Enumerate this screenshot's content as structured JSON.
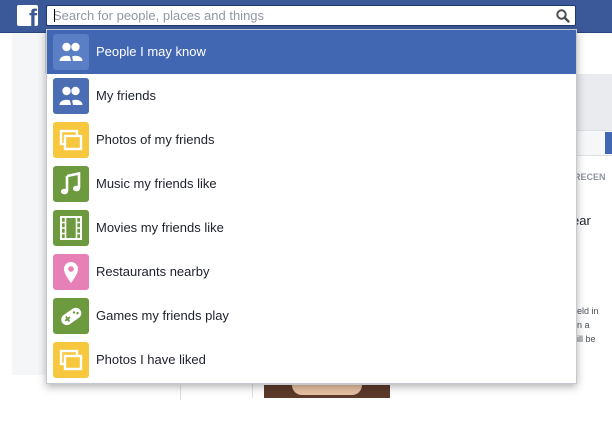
{
  "header": {
    "logo_letter": "f",
    "search": {
      "placeholder": "Search for people, places and things",
      "value": ""
    }
  },
  "background": {
    "frag_recent": "T RECEN",
    "frag_ear": "ear",
    "frag_lines": [
      "eld in",
      "n a",
      "ill be"
    ]
  },
  "suggestions": [
    {
      "label": "People I may know",
      "icon": "people-icon",
      "color": "#ffffff",
      "active": true
    },
    {
      "label": "My friends",
      "icon": "people-icon",
      "color": "#4a6db4",
      "active": false
    },
    {
      "label": "Photos of my friends",
      "icon": "photos-icon",
      "color": "#f7c73d",
      "active": false
    },
    {
      "label": "Music my friends like",
      "icon": "music-icon",
      "color": "#6d9a3f",
      "active": false
    },
    {
      "label": "Movies my friends like",
      "icon": "film-icon",
      "color": "#6d9a3f",
      "active": false
    },
    {
      "label": "Restaurants nearby",
      "icon": "location-pin-icon",
      "color": "#e780b6",
      "active": false
    },
    {
      "label": "Games my friends play",
      "icon": "gamepad-icon",
      "color": "#6d9a3f",
      "active": false
    },
    {
      "label": "Photos I have liked",
      "icon": "photos-icon",
      "color": "#f7c73d",
      "active": false
    }
  ],
  "colors": {
    "brand_blue": "#3b5998",
    "highlight": "#4267b2"
  }
}
